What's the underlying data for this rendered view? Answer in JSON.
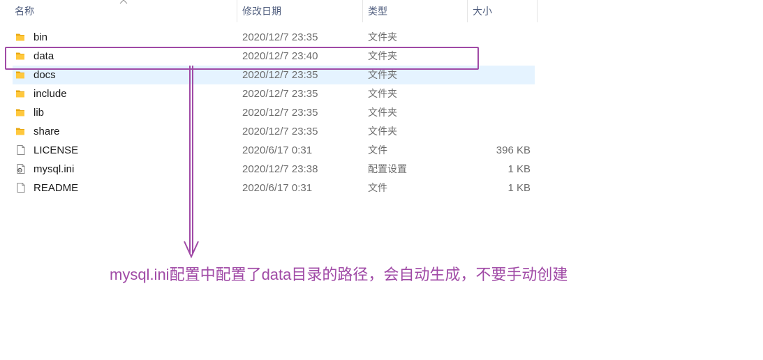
{
  "columns": {
    "name": "名称",
    "date": "修改日期",
    "type": "类型",
    "size": "大小"
  },
  "files": [
    {
      "icon": "folder-icon",
      "name": "bin",
      "date": "2020/12/7 23:35",
      "type": "文件夹",
      "size": ""
    },
    {
      "icon": "folder-icon",
      "name": "data",
      "date": "2020/12/7 23:40",
      "type": "文件夹",
      "size": ""
    },
    {
      "icon": "folder-icon",
      "name": "docs",
      "date": "2020/12/7 23:35",
      "type": "文件夹",
      "size": "",
      "hovered": true
    },
    {
      "icon": "folder-icon",
      "name": "include",
      "date": "2020/12/7 23:35",
      "type": "文件夹",
      "size": ""
    },
    {
      "icon": "folder-icon",
      "name": "lib",
      "date": "2020/12/7 23:35",
      "type": "文件夹",
      "size": ""
    },
    {
      "icon": "folder-icon",
      "name": "share",
      "date": "2020/12/7 23:35",
      "type": "文件夹",
      "size": ""
    },
    {
      "icon": "file-icon",
      "name": "LICENSE",
      "date": "2020/6/17 0:31",
      "type": "文件",
      "size": "396 KB"
    },
    {
      "icon": "config-file-icon",
      "name": "mysql.ini",
      "date": "2020/12/7 23:38",
      "type": "配置设置",
      "size": "1 KB"
    },
    {
      "icon": "file-icon",
      "name": "README",
      "date": "2020/6/17 0:31",
      "type": "文件",
      "size": "1 KB"
    }
  ],
  "annotation": {
    "text": "mysql.ini配置中配置了data目录的路径，会自动生成，不要手动创建",
    "color": "#a04aa6"
  },
  "colors": {
    "folder": "#ffc83d",
    "hover_row": "#e5f3ff",
    "header_text": "#4d5b7c"
  }
}
